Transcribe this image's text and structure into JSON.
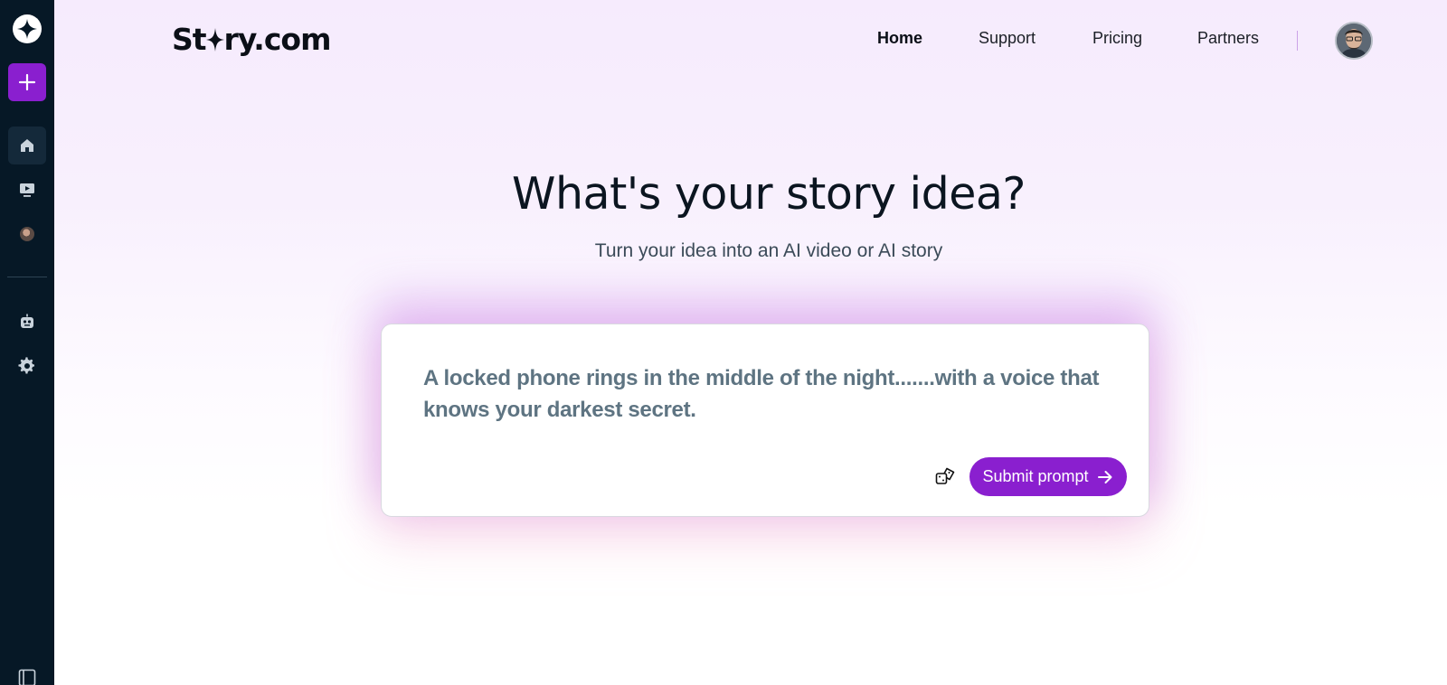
{
  "brand": {
    "name_prefix": "St",
    "name_suffix": "ry.com",
    "accent": "#8a1fcf",
    "sidebar_bg": "#061826"
  },
  "sidebar": {
    "items": [
      {
        "id": "logo",
        "icon": "sparkle-logo-icon"
      },
      {
        "id": "new",
        "icon": "plus-icon"
      },
      {
        "id": "home",
        "icon": "home-icon",
        "active": true
      },
      {
        "id": "videos",
        "icon": "video-play-icon"
      },
      {
        "id": "profile",
        "icon": "avatar-icon"
      },
      {
        "id": "bot",
        "icon": "robot-icon"
      },
      {
        "id": "settings",
        "icon": "gear-icon"
      },
      {
        "id": "collapse",
        "icon": "sidebar-expand-icon"
      }
    ]
  },
  "nav": {
    "home": "Home",
    "support": "Support",
    "pricing": "Pricing",
    "partners": "Partners"
  },
  "hero": {
    "title": "What's your story idea?",
    "subtitle": "Turn your idea into an AI video or AI story"
  },
  "prompt": {
    "text": "A locked phone rings in the middle of the night.......with a voice that knows your darkest secret.",
    "random_icon": "dice-icon",
    "submit_label": "Submit prompt",
    "submit_icon": "arrow-right-icon"
  }
}
